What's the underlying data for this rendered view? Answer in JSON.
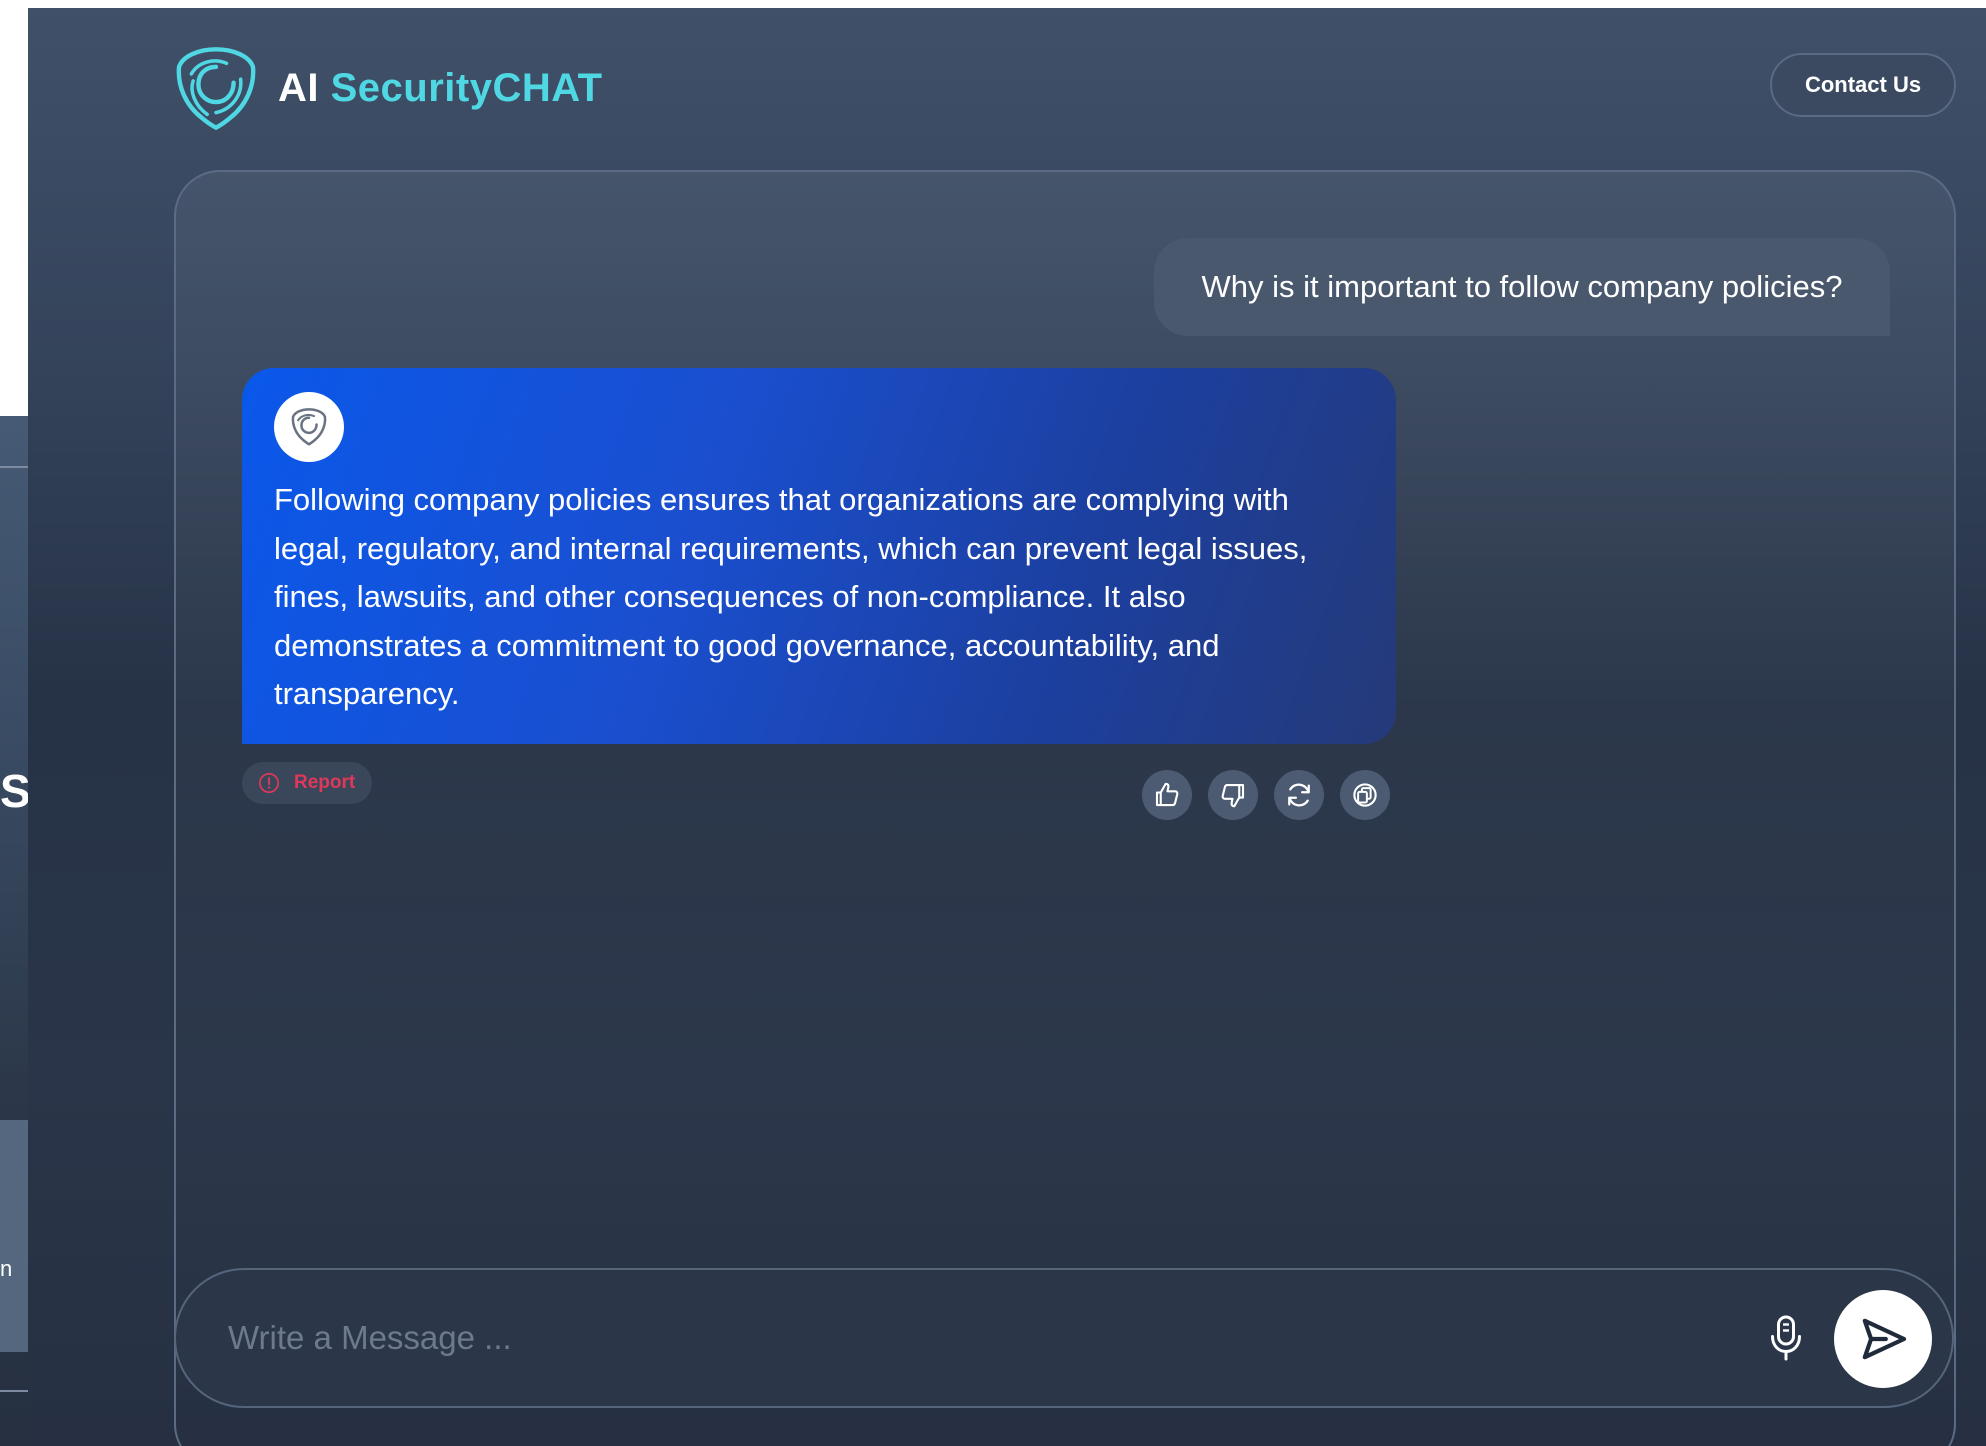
{
  "background_window": {
    "partial_heading": "S",
    "partial_text": "n"
  },
  "header": {
    "brand_ai": "AI",
    "brand_name": "SecurityCHAT",
    "contact_label": "Contact Us"
  },
  "chat": {
    "messages": [
      {
        "role": "user",
        "text": "Why is it important to follow company policies?"
      },
      {
        "role": "assistant",
        "text": "Following company policies ensures that organizations are complying with legal, regulatory, and internal requirements, which can prevent legal issues, fines, lawsuits, and other consequences of non-compliance. It also demonstrates a commitment to good governance, accountability, and transparency."
      }
    ],
    "report_label": "Report",
    "actions": [
      "thumbs-up-icon",
      "thumbs-down-icon",
      "regenerate-icon",
      "copy-icon"
    ]
  },
  "composer": {
    "placeholder": "Write a Message ...",
    "value": ""
  },
  "colors": {
    "brand_accent": "#4fd8e3",
    "assistant_bubble": "#0a58ea",
    "report": "#e0385a"
  }
}
